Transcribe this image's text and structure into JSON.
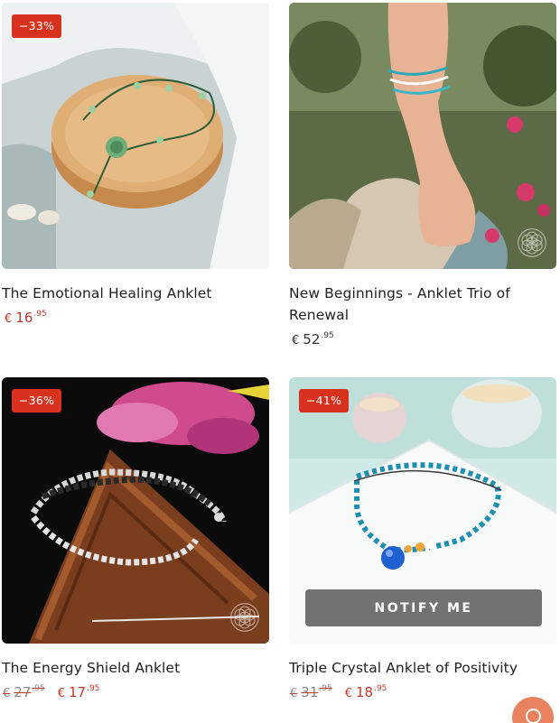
{
  "colors": {
    "sale_badge": "#d8321e",
    "sale_price": "#c0392b",
    "notify_button": "#5f5f5f",
    "chat_button": "#e8825f"
  },
  "products": [
    {
      "title": "The Emotional Healing Anklet",
      "badge": "−33%",
      "price": {
        "currency": "€",
        "whole": "16",
        "cents": ".95"
      },
      "image": "green jade rose anklet on round wooden disc"
    },
    {
      "title": "New Beginnings - Anklet Trio of Renewal",
      "price": {
        "currency": "€",
        "whole": "52",
        "cents": ".95"
      },
      "image": "three turquoise and white anklets on a foot among flowers",
      "icon": "seed-of-life-icon"
    },
    {
      "title": "The Energy Shield Anklet",
      "badge": "−36%",
      "old_price": {
        "currency": "€",
        "whole": "27",
        "cents": ".95"
      },
      "price": {
        "currency": "€",
        "whole": "17",
        "cents": ".95"
      },
      "image": "clear quartz and obsidian anklet on wooden triangle with pink orchid",
      "icon": "seed-of-life-icon"
    },
    {
      "title": "Triple Crystal Anklet of Positivity",
      "badge": "−41%",
      "old_price": {
        "currency": "€",
        "whole": "31",
        "cents": ".95"
      },
      "price": {
        "currency": "€",
        "whole": "18",
        "cents": ".95"
      },
      "image": "turquoise bead anklet with blue agate charm on white tile",
      "notify_label": "NOTIFY ME",
      "icon": "seed-of-life-icon"
    }
  ],
  "chat": {
    "icon": "chat-bubble-icon"
  }
}
